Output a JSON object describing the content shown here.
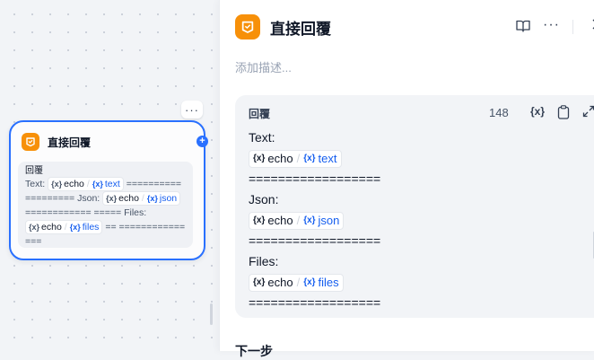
{
  "node": {
    "title": "直接回覆",
    "more_label": "···",
    "plus_label": "+",
    "box_label": "回覆",
    "line1_prefix": "Text:",
    "line1_suffix": "========== ========= Json:",
    "line2_suffix": "============ ===== Files:",
    "line3_suffix": "== ===============",
    "tags": {
      "text": {
        "source": "echo",
        "name": "text"
      },
      "json": {
        "source": "echo",
        "name": "json"
      },
      "files": {
        "source": "echo",
        "name": "files"
      }
    }
  },
  "panel": {
    "title": "直接回覆",
    "description_placeholder": "添加描述...",
    "more_label": "···",
    "reply": {
      "label": "回覆",
      "count": "148",
      "var_icon_label": "{x}",
      "lines": {
        "text_label": "Text:",
        "json_label": "Json:",
        "files_label": "Files:",
        "separator": "=================="
      },
      "tags": {
        "text": {
          "source": "echo",
          "name": "text"
        },
        "json": {
          "source": "echo",
          "name": "json"
        },
        "files": {
          "source": "echo",
          "name": "files"
        }
      }
    },
    "next_step_label": "下一步"
  },
  "icons": {
    "app_icon": "reply-icon",
    "book": "book-open-icon",
    "more": "more-horizontal-icon",
    "copy": "clipboard-icon",
    "expand": "expand-icon",
    "variable": "variable-icon"
  },
  "colors": {
    "accent": "#2970ff",
    "node_icon": "#f79009",
    "variable_name": "#155eef"
  }
}
